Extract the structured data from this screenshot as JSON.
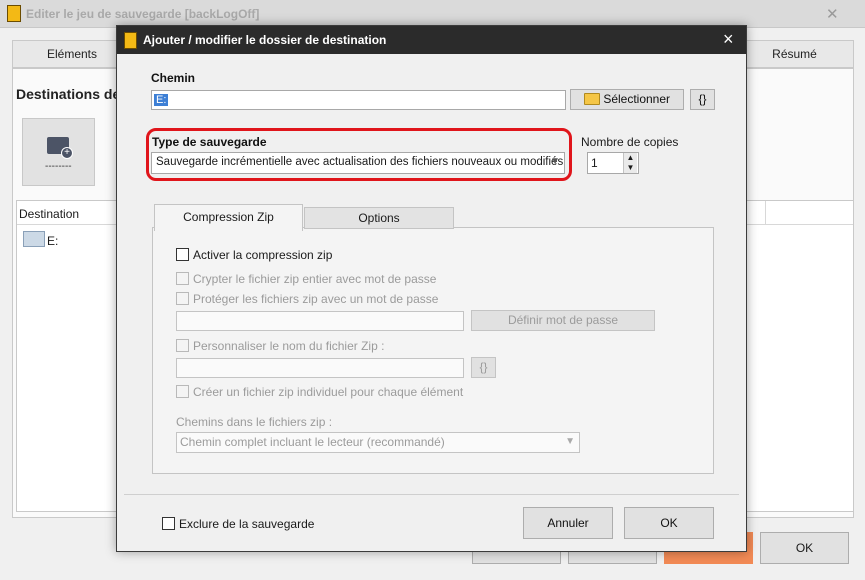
{
  "background_window": {
    "title": "Editer le jeu de sauvegarde   [backLogOff]",
    "tabs": [
      "Eléments",
      "Résumé"
    ],
    "section_title": "Destinations de",
    "big_button_label": "--------",
    "list_column": "Destination",
    "list_rows": [
      "E:"
    ],
    "ok_label": "OK"
  },
  "dialog": {
    "title": "Ajouter / modifier le dossier de destination",
    "path_label": "Chemin",
    "path_value": "E:",
    "select_button": "Sélectionner",
    "braces_button": "{}",
    "backup_type_label": "Type de sauvegarde",
    "backup_type_value": "Sauvegarde incrémentielle avec actualisation des fichiers nouveaux ou modifiés",
    "copies_label": "Nombre de copies",
    "copies_value": "1",
    "tabs": [
      "Compression Zip",
      "Options"
    ],
    "zip": {
      "enable": "Activer la compression zip",
      "encrypt_all": "Crypter le fichier zip entier avec mot de passe",
      "protect_files": "Protéger les fichiers zip avec un mot de passe",
      "define_password": "Définir mot de passe",
      "custom_name": "Personnaliser le nom du fichier Zip :",
      "braces": "{}",
      "individual": "Créer un fichier zip individuel pour chaque élément",
      "paths_label": "Chemins dans le fichiers zip :",
      "paths_value": "Chemin complet incluant le lecteur (recommandé)"
    },
    "exclude_label": "Exclure de la sauvegarde",
    "cancel": "Annuler",
    "ok": "OK"
  },
  "colors": {
    "highlight": "#e0151b",
    "title_bar": "#2b2b2b",
    "selection": "#3d7fd5",
    "accent_orange": "#f28a55"
  },
  "icons": [
    "app-icon",
    "folder-add-icon",
    "folder-icon",
    "close-icon",
    "chevron-down-icon",
    "spin-up-icon",
    "spin-down-icon"
  ]
}
